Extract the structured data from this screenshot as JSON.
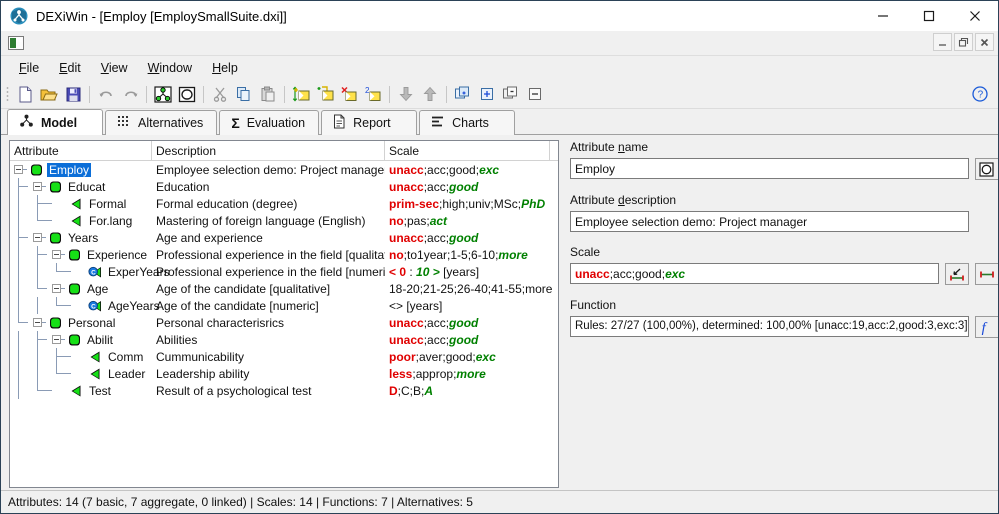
{
  "window": {
    "title": "DEXiWin - [Employ [EmploySmallSuite.dxi]]",
    "app_icon": "dexi-logo-icon",
    "minimize": "—",
    "maximize": "☐",
    "close": "✕",
    "mdi_minimize": "_",
    "mdi_restore": "❐",
    "mdi_close": "✕"
  },
  "menu": {
    "items": [
      {
        "label": "File",
        "accel": "F"
      },
      {
        "label": "Edit",
        "accel": "E"
      },
      {
        "label": "View",
        "accel": "V"
      },
      {
        "label": "Window",
        "accel": "W"
      },
      {
        "label": "Help",
        "accel": "H"
      }
    ]
  },
  "toolbar": {
    "buttons": [
      {
        "name": "new-file-icon"
      },
      {
        "name": "open-folder-icon"
      },
      {
        "name": "save-disk-icon"
      },
      {
        "name": "undo-icon"
      },
      {
        "name": "redo-icon"
      },
      {
        "name": "tree-model-icon"
      },
      {
        "name": "scale-shape-icon"
      },
      {
        "name": "cut-scissors-icon"
      },
      {
        "name": "copy-icon"
      },
      {
        "name": "paste-icon"
      },
      {
        "name": "add-sibling-icon"
      },
      {
        "name": "add-child-icon"
      },
      {
        "name": "delete-attribute-icon"
      },
      {
        "name": "duplicate-attribute-icon"
      },
      {
        "name": "move-down-icon"
      },
      {
        "name": "move-up-icon"
      },
      {
        "name": "expand-all-icon"
      },
      {
        "name": "expand-one-icon"
      },
      {
        "name": "collapse-all-icon"
      },
      {
        "name": "collapse-one-icon"
      }
    ],
    "help_icon": "help-question-icon"
  },
  "tabs": [
    {
      "label": "Model",
      "icon": "tree-icon",
      "active": true
    },
    {
      "label": "Alternatives",
      "icon": "grid-dots-icon",
      "active": false
    },
    {
      "label": "Evaluation",
      "icon": "sigma-icon",
      "active": false
    },
    {
      "label": "Report",
      "icon": "document-icon",
      "active": false
    },
    {
      "label": "Charts",
      "icon": "bars-icon",
      "active": false
    }
  ],
  "grid": {
    "headers": [
      "Attribute",
      "Description",
      "Scale"
    ],
    "rows": [
      {
        "name": "Employ",
        "depth": 0,
        "icon": "aggregate-icon",
        "expander": true,
        "selected": true,
        "description": "Employee selection demo: Project manager",
        "scale": {
          "kind": "ordered",
          "first": "unacc",
          "mid": [
            "acc",
            "good"
          ],
          "last": "exc"
        }
      },
      {
        "name": "Educat",
        "depth": 1,
        "icon": "aggregate-icon",
        "expander": true,
        "selected": false,
        "description": "Education",
        "scale": {
          "kind": "ordered",
          "first": "unacc",
          "mid": [
            "acc"
          ],
          "last": "good"
        }
      },
      {
        "name": "Formal",
        "depth": 2,
        "icon": "basic-icon",
        "expander": false,
        "selected": false,
        "description": "Formal education (degree)",
        "scale": {
          "kind": "ordered",
          "first": "prim-sec",
          "mid": [
            "high",
            "univ",
            "MSc"
          ],
          "last": "PhD"
        }
      },
      {
        "name": "For.lang",
        "depth": 2,
        "icon": "basic-icon",
        "expander": false,
        "selected": false,
        "description": "Mastering of foreign language (English)",
        "scale": {
          "kind": "ordered",
          "first": "no",
          "mid": [
            "pas"
          ],
          "last": "act"
        }
      },
      {
        "name": "Years",
        "depth": 1,
        "icon": "aggregate-icon",
        "expander": true,
        "selected": false,
        "description": "Age and experience",
        "scale": {
          "kind": "ordered",
          "first": "unacc",
          "mid": [
            "acc"
          ],
          "last": "good"
        }
      },
      {
        "name": "Experience",
        "depth": 2,
        "icon": "aggregate-icon",
        "expander": true,
        "selected": false,
        "description": "Professional experience in the field [qualitative]",
        "scale": {
          "kind": "ordered",
          "first": "no",
          "mid": [
            "to1year",
            "1-5",
            "6-10"
          ],
          "last": "more"
        }
      },
      {
        "name": "ExperYears",
        "depth": 3,
        "icon": "continuous-icon",
        "expander": false,
        "selected": false,
        "description": "Professional experience in the field [numeric]",
        "scale": {
          "kind": "continuous",
          "lo": "< 0",
          "sep": ":",
          "hi": "10 >",
          "unit": "[years]"
        }
      },
      {
        "name": "Age",
        "depth": 2,
        "icon": "aggregate-icon",
        "expander": true,
        "selected": false,
        "description": "Age of the candidate [qualitative]",
        "scale": {
          "kind": "plain",
          "text": "18-20;21-25;26-40;41-55;more"
        }
      },
      {
        "name": "AgeYears",
        "depth": 3,
        "icon": "continuous-icon",
        "expander": false,
        "selected": false,
        "description": "Age of the candidate [numeric]",
        "scale": {
          "kind": "plain",
          "text": "<> [years]"
        }
      },
      {
        "name": "Personal",
        "depth": 1,
        "icon": "aggregate-icon",
        "expander": true,
        "selected": false,
        "description": "Personal characterisrics",
        "scale": {
          "kind": "ordered",
          "first": "unacc",
          "mid": [
            "acc"
          ],
          "last": "good"
        }
      },
      {
        "name": "Abilit",
        "depth": 2,
        "icon": "aggregate-icon",
        "expander": true,
        "selected": false,
        "description": "Abilities",
        "scale": {
          "kind": "ordered",
          "first": "unacc",
          "mid": [
            "acc"
          ],
          "last": "good"
        }
      },
      {
        "name": "Comm",
        "depth": 3,
        "icon": "basic-icon",
        "expander": false,
        "selected": false,
        "description": "Cummunicability",
        "scale": {
          "kind": "ordered",
          "first": "poor",
          "mid": [
            "aver",
            "good"
          ],
          "last": "exc"
        }
      },
      {
        "name": "Leader",
        "depth": 3,
        "icon": "basic-icon",
        "expander": false,
        "selected": false,
        "description": "Leadership ability",
        "scale": {
          "kind": "ordered",
          "first": "less",
          "mid": [
            "approp"
          ],
          "last": "more"
        }
      },
      {
        "name": "Test",
        "depth": 2,
        "icon": "basic-icon",
        "expander": false,
        "selected": false,
        "description": "Result of a psychological test",
        "scale": {
          "kind": "ordered",
          "first": "D",
          "mid": [
            "C",
            "B"
          ],
          "last": "A"
        }
      }
    ]
  },
  "editor": {
    "attribute_name": {
      "label": "Attribute name",
      "accel": "n",
      "value": "Employ",
      "button_icon": "scale-shape-icon"
    },
    "attribute_description": {
      "label": "Attribute description",
      "accel": "d",
      "value": "Employee selection demo: Project manager"
    },
    "scale": {
      "label": "Scale",
      "value": {
        "first": "unacc",
        "mid": [
          "acc",
          "good"
        ],
        "last": "exc"
      },
      "button1_icon": "edit-scale-icon",
      "button2_icon": "scale-range-icon"
    },
    "function": {
      "label": "Function",
      "value": "Rules: 27/27 (100,00%), determined: 100,00% [unacc:19,acc:2,good:3,exc:3]",
      "button_icon": "function-icon"
    }
  },
  "statusbar": {
    "text": "Attributes: 14 (7 basic, 7 aggregate, 0 linked)  |  Scales: 14  |  Functions: 7  |  Alternatives: 5"
  },
  "colors": {
    "accent": "#0b6ed8",
    "scale_first": "#e00000",
    "scale_last": "#008000",
    "titlebar_border": "#2b4257"
  }
}
